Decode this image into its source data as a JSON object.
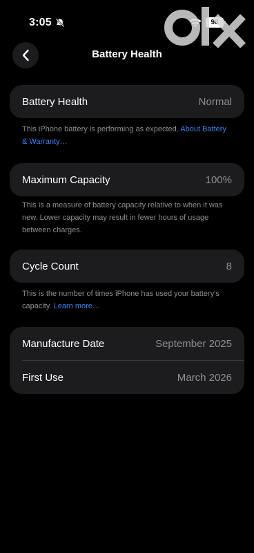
{
  "status_bar": {
    "time": "3:05",
    "battery_level": "98"
  },
  "watermark": {
    "text": "olx"
  },
  "nav": {
    "title": "Battery Health",
    "back_icon": "chevron-left-icon"
  },
  "health": {
    "label": "Battery Health",
    "value": "Normal",
    "footnote": "This iPhone battery is performing as expected. ",
    "footnote_link": "About Battery & Warranty…"
  },
  "capacity": {
    "label": "Maximum Capacity",
    "value": "100%",
    "footnote": "This is a measure of battery capacity relative to when it was new. Lower capacity may result in fewer hours of usage between charges."
  },
  "cycles": {
    "label": "Cycle Count",
    "value": "8",
    "footnote": "This is the number of times iPhone has used your battery's capacity. ",
    "footnote_link": "Learn more…"
  },
  "dates": {
    "manufacture_label": "Manufacture Date",
    "manufacture_value": "September 2025",
    "first_use_label": "First Use",
    "first_use_value": "March 2026"
  },
  "colors": {
    "background": "#000000",
    "card": "#1c1c1e",
    "secondary_text": "#8e8e93",
    "link": "#3b82f6"
  }
}
